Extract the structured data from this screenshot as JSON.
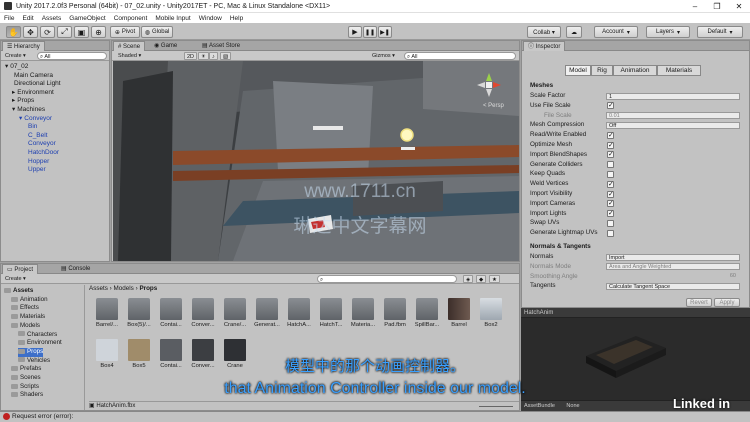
{
  "window": {
    "title": "Unity 2017.2.0f3 Personal (64bit) - 07_02.unity - Unity2017ET - PC, Mac & Linux Standalone <DX11>",
    "controls": [
      "–",
      "❐",
      "✕"
    ]
  },
  "menu": [
    "File",
    "Edit",
    "Assets",
    "GameObject",
    "Component",
    "Mobile Input",
    "Window",
    "Help"
  ],
  "toolbar": {
    "pivot": "Pivot",
    "global": "Global",
    "collab": "Collab ▾",
    "account": "Account",
    "layers": "Layers",
    "layout": "Default"
  },
  "hierarchy": {
    "tab": "Hierarchy",
    "create": "Create ▾",
    "search_placeholder": "All",
    "rows": [
      {
        "label": "07_02",
        "indent": 0,
        "blue": false
      },
      {
        "label": "Main Camera",
        "indent": 1,
        "blue": false
      },
      {
        "label": "Directional Light",
        "indent": 1,
        "blue": false
      },
      {
        "label": "Environment",
        "indent": 1,
        "blue": false
      },
      {
        "label": "Props",
        "indent": 1,
        "blue": false
      },
      {
        "label": "Machines",
        "indent": 1,
        "blue": false
      },
      {
        "label": "Conveyor",
        "indent": 2,
        "blue": true
      },
      {
        "label": "Bin",
        "indent": 3,
        "blue": true
      },
      {
        "label": "C_Belt",
        "indent": 3,
        "blue": true
      },
      {
        "label": "Conveyor",
        "indent": 3,
        "blue": true
      },
      {
        "label": "HatchDoor",
        "indent": 3,
        "blue": true
      },
      {
        "label": "Hopper",
        "indent": 3,
        "blue": true
      },
      {
        "label": "Upper",
        "indent": 3,
        "blue": true
      }
    ]
  },
  "scene": {
    "tabs": [
      "Scene",
      "Game",
      "Asset Store"
    ],
    "shading": "Shaded",
    "mode2d": "2D",
    "gizmos": "Gizmos ▾",
    "search_placeholder": "All",
    "persp": "< Persp",
    "axis_labels": {
      "y": "y",
      "x": "x"
    }
  },
  "inspector": {
    "tab": "Inspector",
    "tabs": [
      "Model",
      "Rig",
      "Animation",
      "Materials"
    ],
    "meshes_header": "Meshes",
    "rows": [
      {
        "label": "Scale Factor",
        "type": "field",
        "value": "1"
      },
      {
        "label": "Use File Scale",
        "type": "check",
        "checked": true
      },
      {
        "label": "File Scale",
        "type": "field",
        "value": "0.01",
        "dim": true
      },
      {
        "label": "Mesh Compression",
        "type": "field",
        "value": "Off"
      },
      {
        "label": "Read/Write Enabled",
        "type": "check",
        "checked": true
      },
      {
        "label": "Optimize Mesh",
        "type": "check",
        "checked": true
      },
      {
        "label": "Import BlendShapes",
        "type": "check",
        "checked": true
      },
      {
        "label": "Generate Colliders",
        "type": "check",
        "checked": false
      },
      {
        "label": "Keep Quads",
        "type": "check",
        "checked": false
      },
      {
        "label": "Weld Vertices",
        "type": "check",
        "checked": true
      },
      {
        "label": "Import Visibility",
        "type": "check",
        "checked": true
      },
      {
        "label": "Import Cameras",
        "type": "check",
        "checked": true
      },
      {
        "label": "Import Lights",
        "type": "check",
        "checked": true
      },
      {
        "label": "Swap UVs",
        "type": "check",
        "checked": false
      },
      {
        "label": "Generate Lightmap UVs",
        "type": "check",
        "checked": false
      }
    ],
    "normals_header": "Normals & Tangents",
    "normals": [
      {
        "label": "Normals",
        "value": "Import",
        "dim": false
      },
      {
        "label": "Normals Mode",
        "value": "Area and Angle Weighted",
        "dim": true
      },
      {
        "label": "Smoothing Angle",
        "value": "60",
        "dim": true
      },
      {
        "label": "Tangents",
        "value": "Calculate Tangent Space",
        "dim": false
      }
    ],
    "revert": "Revert",
    "apply": "Apply"
  },
  "preview": {
    "title": "HatchAnim",
    "asset_bundle": "AssetBundle",
    "bundle_value": "None"
  },
  "project": {
    "tabs": [
      "Project",
      "Console"
    ],
    "create": "Create ▾",
    "breadcrumb": [
      "Assets",
      "Models",
      "Props"
    ],
    "tree": [
      {
        "label": "Assets",
        "indent": 0,
        "bold": true
      },
      {
        "label": "Animation",
        "indent": 1,
        "bold": false
      },
      {
        "label": "Effects",
        "indent": 1,
        "bold": false
      },
      {
        "label": "Materials",
        "indent": 1,
        "bold": false
      },
      {
        "label": "Models",
        "indent": 1,
        "bold": false
      },
      {
        "label": "Characters",
        "indent": 2,
        "bold": false
      },
      {
        "label": "Environment",
        "indent": 2,
        "bold": false
      },
      {
        "label": "Props",
        "indent": 2,
        "bold": false,
        "selected": true
      },
      {
        "label": "Vehicles",
        "indent": 2,
        "bold": false
      },
      {
        "label": "Prefabs",
        "indent": 1,
        "bold": false
      },
      {
        "label": "Scenes",
        "indent": 1,
        "bold": false
      },
      {
        "label": "Scripts",
        "indent": 1,
        "bold": false
      },
      {
        "label": "Shaders",
        "indent": 1,
        "bold": false
      }
    ],
    "assets_row1": [
      "Barrel/...",
      "Box(5)/...",
      "Contai...",
      "Conver...",
      "Crane/...",
      "Generat...",
      "HatchA...",
      "HatchT...",
      "Materia...",
      "Pad.fbm",
      "SpillBar...",
      "Barrel",
      "Box2"
    ],
    "assets_row2": [
      "Box4",
      "Box5",
      "Contai...",
      "Conver...",
      "Crane"
    ],
    "selected_file": "HatchAnim.fbx"
  },
  "status": {
    "message": "Request error (error):"
  },
  "overlay": {
    "watermark": "www.1711.cn",
    "watermark_cn": "琳达中文字幕网",
    "subtitle_cn": "模型中的那个动画控制器。",
    "subtitle_en": "that Animation Controller inside our model.",
    "brand": "Linked in"
  },
  "colors": {
    "panel": "#c2c2c2",
    "selection_blue": "#3d6fc9",
    "hierarchy_blue": "#1d3fb0",
    "subtitle": "#3aa0ff"
  }
}
